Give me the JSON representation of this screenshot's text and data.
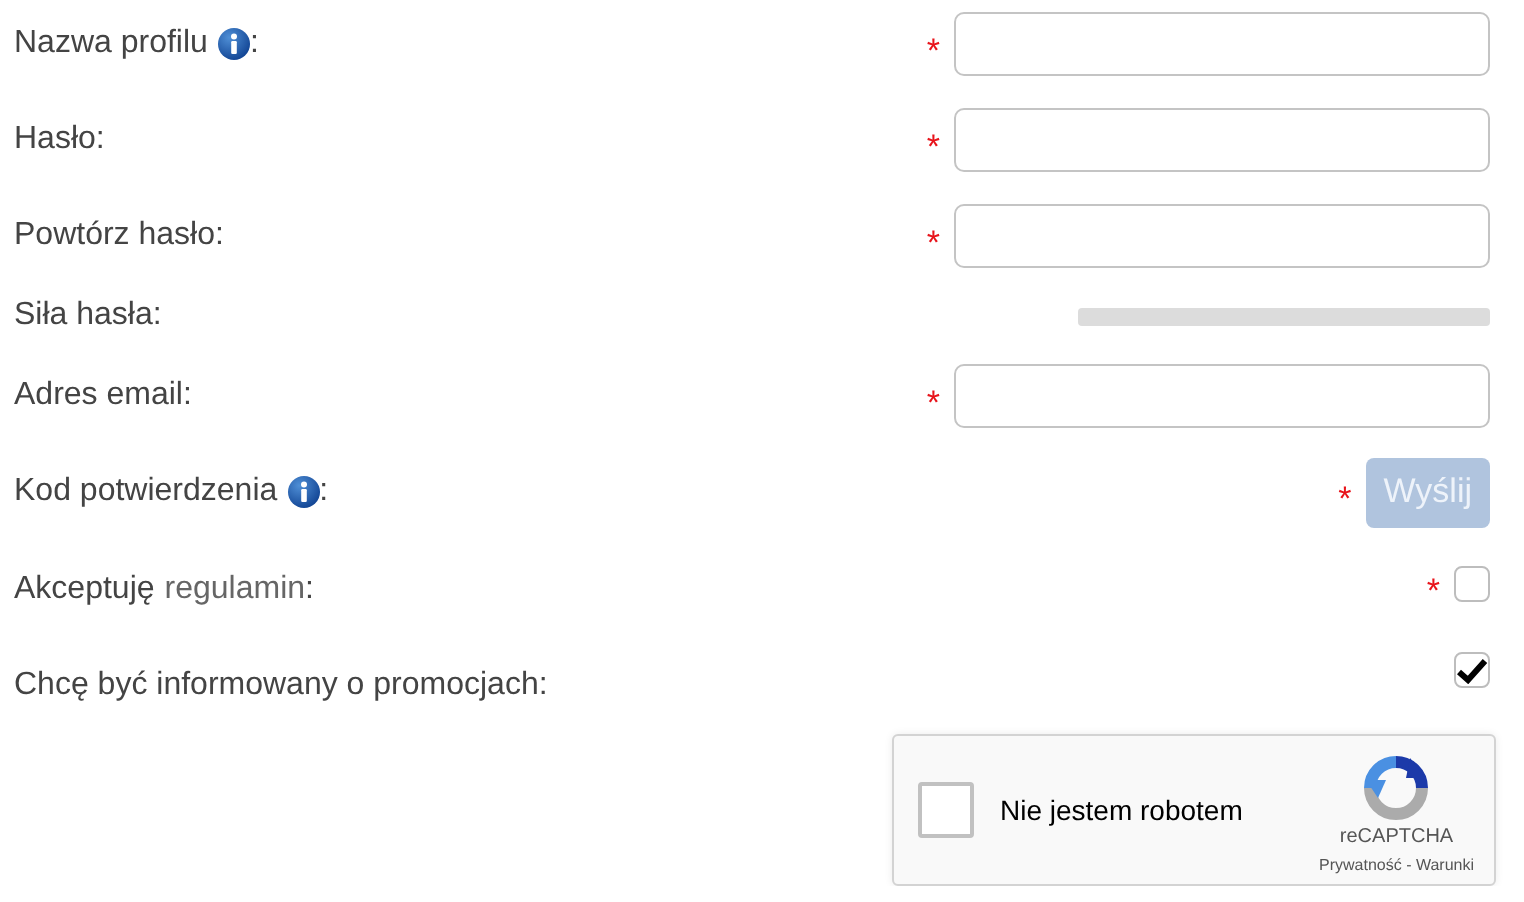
{
  "fields": [
    {
      "kind": "text",
      "label": "Nazwa profilu",
      "info": true,
      "suffix": ":",
      "mark": "*"
    },
    {
      "kind": "text",
      "label": "Hasło:",
      "info": false,
      "mark": "*"
    },
    {
      "kind": "text",
      "label": "Powtórz hasło:",
      "info": false,
      "mark": "*"
    },
    {
      "kind": "meter",
      "label": "Siła hasła:",
      "info": false,
      "level": 0
    },
    {
      "kind": "text",
      "label": "Adres email:",
      "info": false,
      "mark": "*"
    },
    {
      "kind": "button",
      "label": "Kod potwierdzenia",
      "info": true,
      "suffix": ":",
      "mark": "*",
      "button": "Wyślij",
      "disabled": true
    },
    {
      "kind": "checkbox",
      "label": "Akceptuję",
      "link": "regulamin",
      "suffix": ":",
      "info": false,
      "mark": "*",
      "checked": false
    },
    {
      "kind": "checkbox",
      "label": "Chcę być informowany o promocjach:",
      "info": false,
      "checked": true
    }
  ],
  "captcha": {
    "label": "Nie jestem robotem",
    "checked": false,
    "brand": "reCAPTCHA",
    "footer": "Prywatność - Warunki"
  }
}
